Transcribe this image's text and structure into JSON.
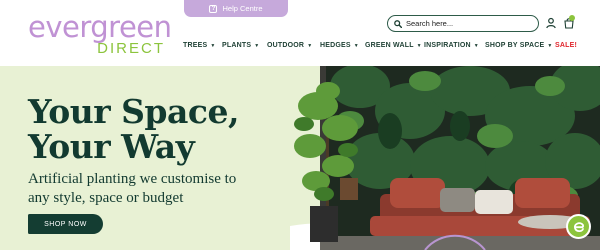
{
  "help": {
    "label": "Help Centre",
    "icon": "question-icon"
  },
  "logo": {
    "word": "evergreen",
    "sub": "DIRECT"
  },
  "search": {
    "placeholder": "Search here..."
  },
  "header_icons": [
    "user-icon",
    "bag-icon"
  ],
  "nav": [
    {
      "label": "TREES"
    },
    {
      "label": "PLANTS"
    },
    {
      "label": "OUTDOOR"
    },
    {
      "label": "HEDGES"
    },
    {
      "label": "GREEN WALL"
    },
    {
      "label": "INSPIRATION"
    },
    {
      "label": "SHOP BY SPACE"
    },
    {
      "label": "SALE!"
    }
  ],
  "hero": {
    "title_line1": "Your Space,",
    "title_line2": "Your Way",
    "subtitle_line1": "Artificial planting we customise to",
    "subtitle_line2": "any style, space or budget",
    "cta": "SHOP NOW"
  },
  "colors": {
    "brand_purple": "#c092d4",
    "brand_green": "#8cc43d",
    "dark_green": "#143d32",
    "hero_bg": "#e8f1d4",
    "sale_red": "#e0242b"
  }
}
